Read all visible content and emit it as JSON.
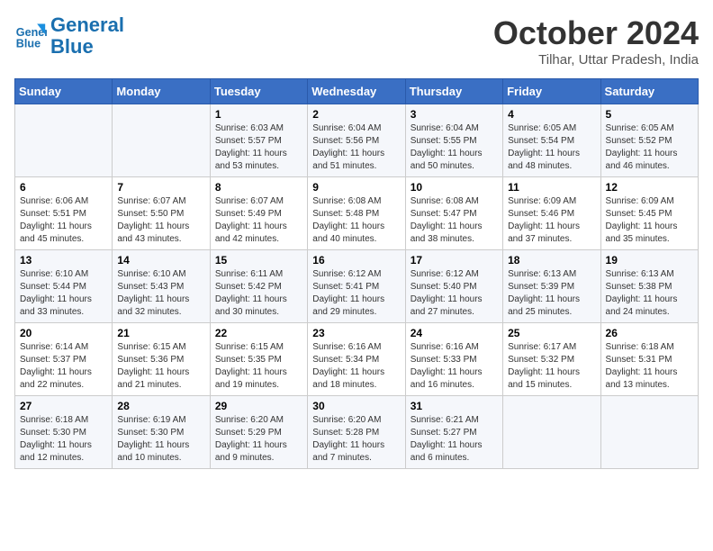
{
  "header": {
    "logo_line1": "General",
    "logo_line2": "Blue",
    "month": "October 2024",
    "location": "Tilhar, Uttar Pradesh, India"
  },
  "days_of_week": [
    "Sunday",
    "Monday",
    "Tuesday",
    "Wednesday",
    "Thursday",
    "Friday",
    "Saturday"
  ],
  "weeks": [
    [
      {
        "day": "",
        "info": ""
      },
      {
        "day": "",
        "info": ""
      },
      {
        "day": "1",
        "info": "Sunrise: 6:03 AM\nSunset: 5:57 PM\nDaylight: 11 hours and 53 minutes."
      },
      {
        "day": "2",
        "info": "Sunrise: 6:04 AM\nSunset: 5:56 PM\nDaylight: 11 hours and 51 minutes."
      },
      {
        "day": "3",
        "info": "Sunrise: 6:04 AM\nSunset: 5:55 PM\nDaylight: 11 hours and 50 minutes."
      },
      {
        "day": "4",
        "info": "Sunrise: 6:05 AM\nSunset: 5:54 PM\nDaylight: 11 hours and 48 minutes."
      },
      {
        "day": "5",
        "info": "Sunrise: 6:05 AM\nSunset: 5:52 PM\nDaylight: 11 hours and 46 minutes."
      }
    ],
    [
      {
        "day": "6",
        "info": "Sunrise: 6:06 AM\nSunset: 5:51 PM\nDaylight: 11 hours and 45 minutes."
      },
      {
        "day": "7",
        "info": "Sunrise: 6:07 AM\nSunset: 5:50 PM\nDaylight: 11 hours and 43 minutes."
      },
      {
        "day": "8",
        "info": "Sunrise: 6:07 AM\nSunset: 5:49 PM\nDaylight: 11 hours and 42 minutes."
      },
      {
        "day": "9",
        "info": "Sunrise: 6:08 AM\nSunset: 5:48 PM\nDaylight: 11 hours and 40 minutes."
      },
      {
        "day": "10",
        "info": "Sunrise: 6:08 AM\nSunset: 5:47 PM\nDaylight: 11 hours and 38 minutes."
      },
      {
        "day": "11",
        "info": "Sunrise: 6:09 AM\nSunset: 5:46 PM\nDaylight: 11 hours and 37 minutes."
      },
      {
        "day": "12",
        "info": "Sunrise: 6:09 AM\nSunset: 5:45 PM\nDaylight: 11 hours and 35 minutes."
      }
    ],
    [
      {
        "day": "13",
        "info": "Sunrise: 6:10 AM\nSunset: 5:44 PM\nDaylight: 11 hours and 33 minutes."
      },
      {
        "day": "14",
        "info": "Sunrise: 6:10 AM\nSunset: 5:43 PM\nDaylight: 11 hours and 32 minutes."
      },
      {
        "day": "15",
        "info": "Sunrise: 6:11 AM\nSunset: 5:42 PM\nDaylight: 11 hours and 30 minutes."
      },
      {
        "day": "16",
        "info": "Sunrise: 6:12 AM\nSunset: 5:41 PM\nDaylight: 11 hours and 29 minutes."
      },
      {
        "day": "17",
        "info": "Sunrise: 6:12 AM\nSunset: 5:40 PM\nDaylight: 11 hours and 27 minutes."
      },
      {
        "day": "18",
        "info": "Sunrise: 6:13 AM\nSunset: 5:39 PM\nDaylight: 11 hours and 25 minutes."
      },
      {
        "day": "19",
        "info": "Sunrise: 6:13 AM\nSunset: 5:38 PM\nDaylight: 11 hours and 24 minutes."
      }
    ],
    [
      {
        "day": "20",
        "info": "Sunrise: 6:14 AM\nSunset: 5:37 PM\nDaylight: 11 hours and 22 minutes."
      },
      {
        "day": "21",
        "info": "Sunrise: 6:15 AM\nSunset: 5:36 PM\nDaylight: 11 hours and 21 minutes."
      },
      {
        "day": "22",
        "info": "Sunrise: 6:15 AM\nSunset: 5:35 PM\nDaylight: 11 hours and 19 minutes."
      },
      {
        "day": "23",
        "info": "Sunrise: 6:16 AM\nSunset: 5:34 PM\nDaylight: 11 hours and 18 minutes."
      },
      {
        "day": "24",
        "info": "Sunrise: 6:16 AM\nSunset: 5:33 PM\nDaylight: 11 hours and 16 minutes."
      },
      {
        "day": "25",
        "info": "Sunrise: 6:17 AM\nSunset: 5:32 PM\nDaylight: 11 hours and 15 minutes."
      },
      {
        "day": "26",
        "info": "Sunrise: 6:18 AM\nSunset: 5:31 PM\nDaylight: 11 hours and 13 minutes."
      }
    ],
    [
      {
        "day": "27",
        "info": "Sunrise: 6:18 AM\nSunset: 5:30 PM\nDaylight: 11 hours and 12 minutes."
      },
      {
        "day": "28",
        "info": "Sunrise: 6:19 AM\nSunset: 5:30 PM\nDaylight: 11 hours and 10 minutes."
      },
      {
        "day": "29",
        "info": "Sunrise: 6:20 AM\nSunset: 5:29 PM\nDaylight: 11 hours and 9 minutes."
      },
      {
        "day": "30",
        "info": "Sunrise: 6:20 AM\nSunset: 5:28 PM\nDaylight: 11 hours and 7 minutes."
      },
      {
        "day": "31",
        "info": "Sunrise: 6:21 AM\nSunset: 5:27 PM\nDaylight: 11 hours and 6 minutes."
      },
      {
        "day": "",
        "info": ""
      },
      {
        "day": "",
        "info": ""
      }
    ]
  ]
}
